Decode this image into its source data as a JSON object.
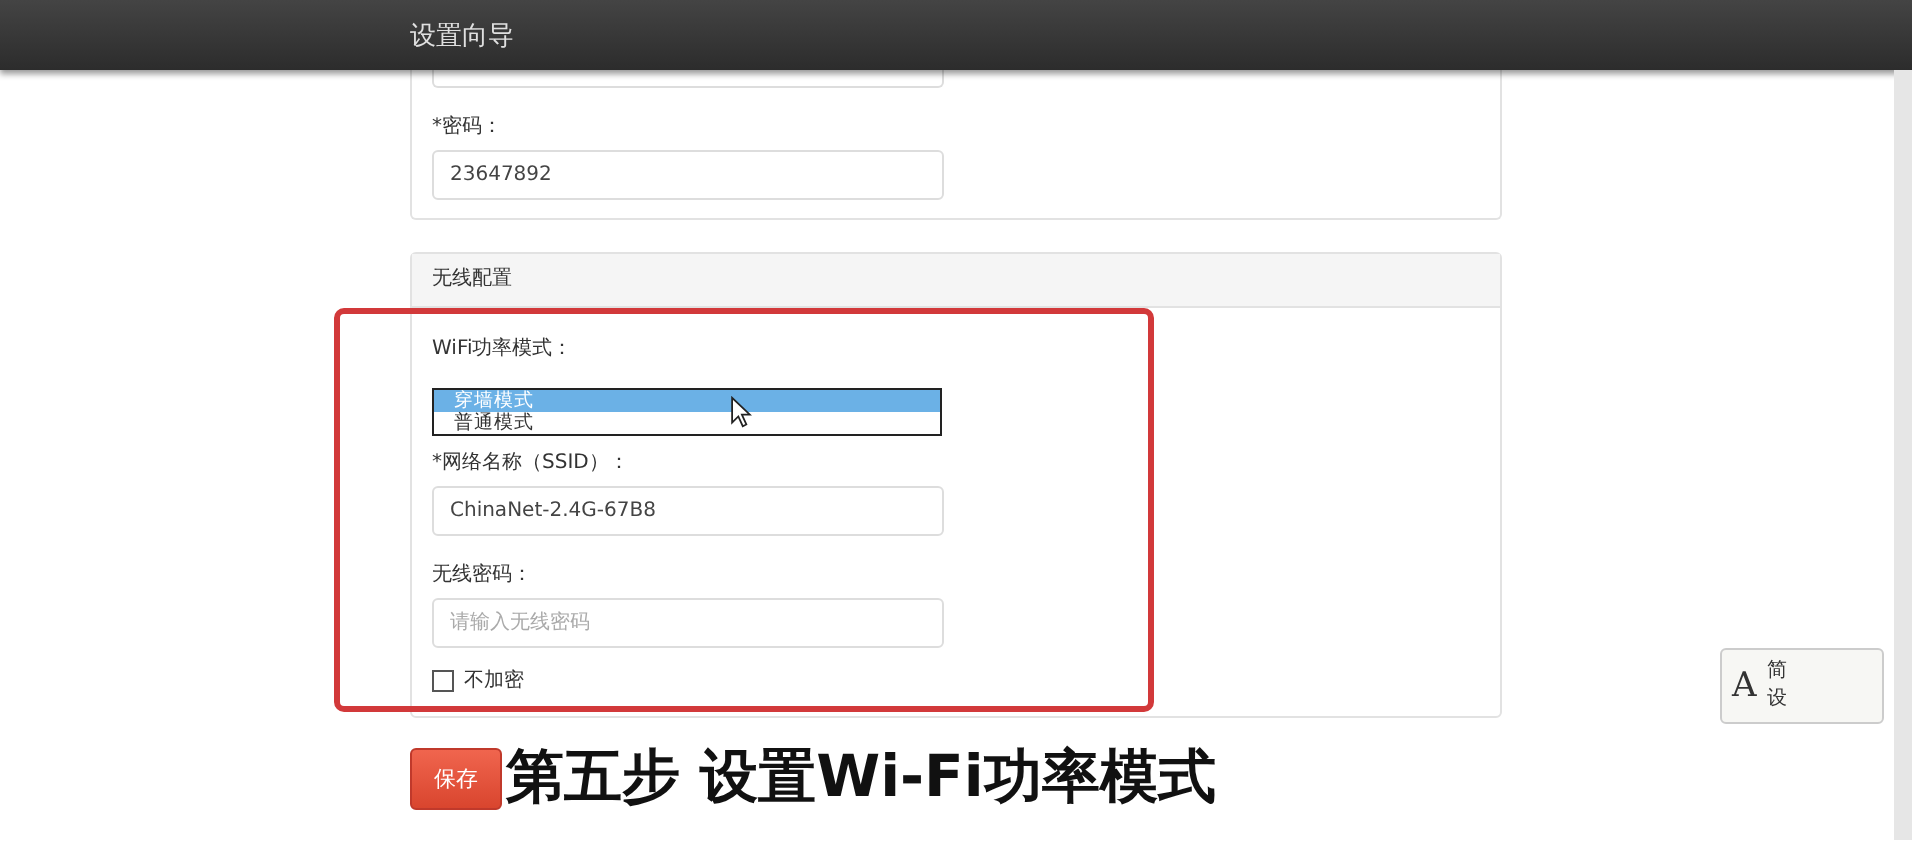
{
  "header": {
    "title": "设置向导"
  },
  "account": {
    "password": {
      "label": "*密码：",
      "value": "23647892"
    }
  },
  "wireless": {
    "title": "无线配置",
    "power_mode": {
      "label": "WiFi功率模式：",
      "options": [
        {
          "label": "穿墙模式",
          "selected": true
        },
        {
          "label": "普通模式",
          "selected": false
        }
      ]
    },
    "ssid": {
      "label": "*网络名称（SSID）：",
      "value": "ChinaNet-2.4G-67B8"
    },
    "password": {
      "label": "无线密码：",
      "placeholder": "请输入无线密码"
    },
    "no_encryption": {
      "label": "不加密",
      "checked": false
    }
  },
  "save_button": {
    "label": "保存"
  },
  "caption": "第五步 设置Wi-Fi功率模式",
  "ime_badge": {
    "letter": "A",
    "chars": [
      "简",
      "设"
    ]
  }
}
